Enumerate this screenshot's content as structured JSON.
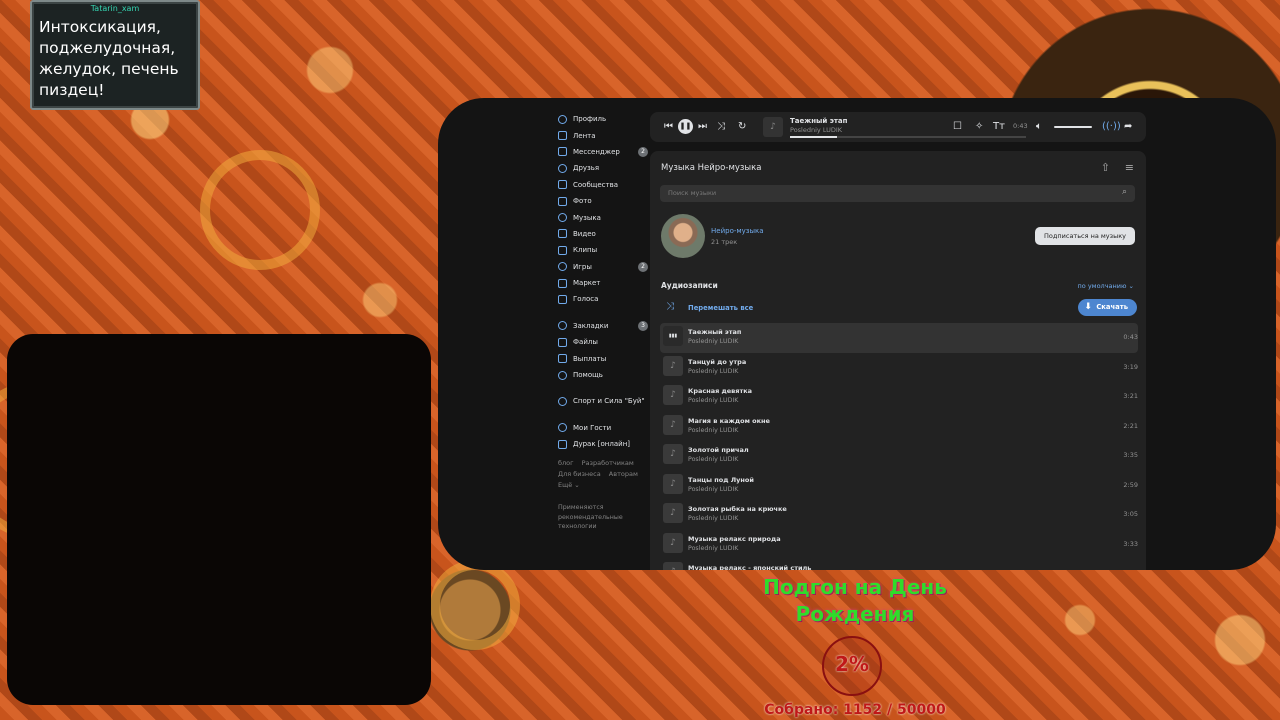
{
  "chat": {
    "username": "Tatarin_xam",
    "message": "Интоксикация, поджелудочная, желудок, печень пиздец!"
  },
  "colors": {
    "accent": "#71aaeb",
    "panel": "#222222",
    "goal_title": "#2fdc2a",
    "goal_sum": "#c01818"
  },
  "nav": {
    "items": [
      {
        "label": "Профиль",
        "icon": "profile-icon"
      },
      {
        "label": "Лента",
        "icon": "feed-icon"
      },
      {
        "label": "Мессенджер",
        "icon": "messenger-icon",
        "badge": "2"
      },
      {
        "label": "Друзья",
        "icon": "friends-icon"
      },
      {
        "label": "Сообщества",
        "icon": "communities-icon"
      },
      {
        "label": "Фото",
        "icon": "photo-icon"
      },
      {
        "label": "Музыка",
        "icon": "music-icon"
      },
      {
        "label": "Видео",
        "icon": "video-icon"
      },
      {
        "label": "Клипы",
        "icon": "clips-icon"
      },
      {
        "label": "Игры",
        "icon": "games-icon",
        "badge": "2"
      },
      {
        "label": "Маркет",
        "icon": "market-icon"
      },
      {
        "label": "Голоса",
        "icon": "votes-icon"
      }
    ],
    "items2": [
      {
        "label": "Закладки",
        "icon": "bookmarks-icon",
        "badge": "3"
      },
      {
        "label": "Файлы",
        "icon": "files-icon"
      },
      {
        "label": "Выплаты",
        "icon": "payouts-icon"
      },
      {
        "label": "Помощь",
        "icon": "help-icon"
      }
    ],
    "items3": [
      {
        "label": "Спорт и Сила \"Буй\"",
        "icon": "group-icon"
      }
    ],
    "items4": [
      {
        "label": "Мои Гости",
        "icon": "guests-icon"
      },
      {
        "label": "Дурак [онлайн]",
        "icon": "game-icon"
      }
    ],
    "footer": {
      "blog": "блог",
      "developers": "Разработчикам",
      "business": "Для бизнеса",
      "authors": "Авторам",
      "more": "Ещё ⌄"
    },
    "note": "Применяются рекомендательные технологии"
  },
  "player": {
    "title": "Таежный этап",
    "artist": "Posledniy LUDIK",
    "time": "0:43",
    "progress": 0.2,
    "volume": 1.0
  },
  "music": {
    "title": "Музыка Нейро-музыка",
    "search_placeholder": "Поиск музыки",
    "owner": "Нейро-музыка",
    "count": "21 трек",
    "subscribe": "Подписаться на музыку",
    "section": "Аудиозаписи",
    "sort": "по умолчанию ⌄",
    "shuffle": "Перемешать все",
    "download": "Скачать",
    "tracks": [
      {
        "title": "Таежный этап",
        "artist": "Posledniy LUDIK",
        "duration": "0:43"
      },
      {
        "title": "Танцуй до утра",
        "artist": "Posledniy LUDIK",
        "duration": "3:19"
      },
      {
        "title": "Красная девятка",
        "artist": "Posledniy LUDIK",
        "duration": "3:21"
      },
      {
        "title": "Магия в каждом окне",
        "artist": "Posledniy LUDIK",
        "duration": "2:21"
      },
      {
        "title": "Золотой причал",
        "artist": "Posledniy LUDIK",
        "duration": "3:35"
      },
      {
        "title": "Танцы под Луной",
        "artist": "Posledniy LUDIK",
        "duration": "2:59"
      },
      {
        "title": "Золотая рыбка на крючке",
        "artist": "Posledniy LUDIK",
        "duration": "3:05"
      },
      {
        "title": "Музыка релакс природа",
        "artist": "Posledniy LUDIK",
        "duration": "3:33"
      },
      {
        "title": "Музыка релакс - японский стиль",
        "artist": "",
        "duration": ""
      }
    ]
  },
  "goal": {
    "title": "Подгон на День Рождения",
    "percent": "2%",
    "collected": "Собрано: 1152 / 50000"
  }
}
